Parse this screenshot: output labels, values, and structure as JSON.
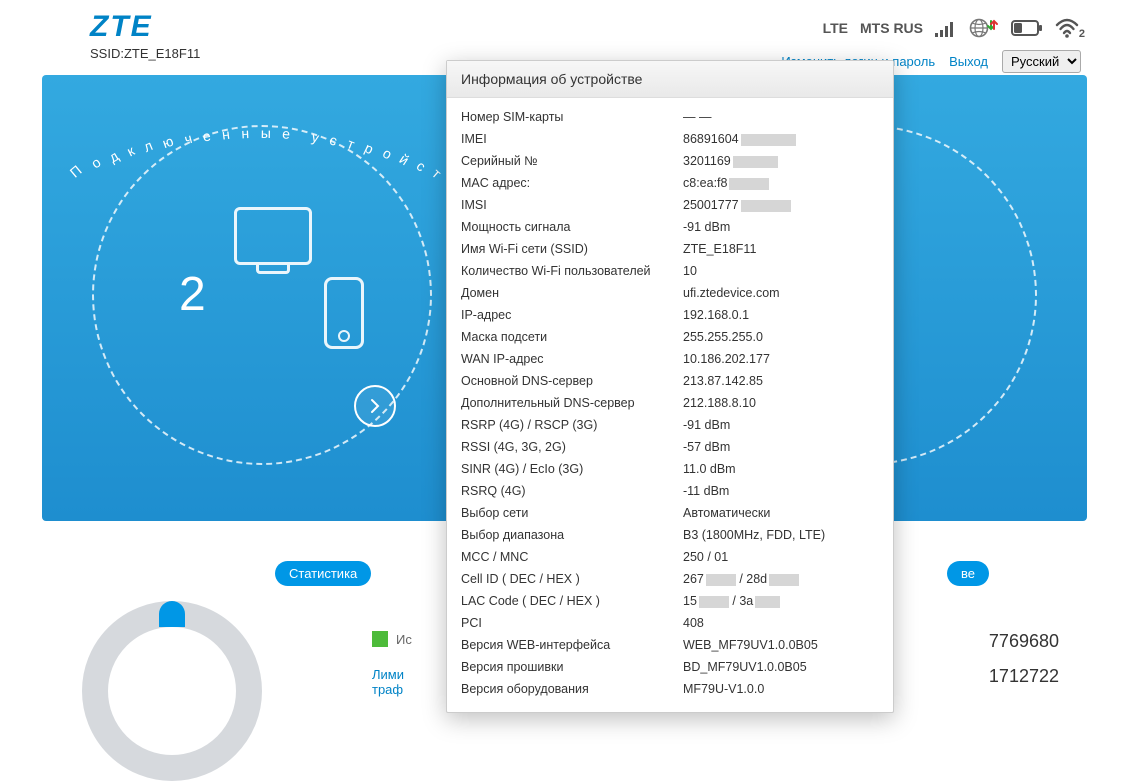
{
  "header": {
    "logo": "ZTE",
    "ssid_label": "SSID:",
    "ssid_value": "ZTE_E18F11",
    "net_type": "LTE",
    "operator": "MTS RUS",
    "change_login": "Изменить логин и пароль",
    "logout": "Выход",
    "language": "Русский",
    "wifi_count": "2"
  },
  "hero": {
    "left_title": "Подключенные устройства",
    "device_count": "2"
  },
  "stats": {
    "badge_left": "Статистика",
    "used_label": "Ис",
    "limit_link": "Лими\nтраф",
    "badge_right": "ве",
    "num1": "7769680",
    "num2": "1712722"
  },
  "modal": {
    "title": "Информация об устройстве",
    "rows": [
      {
        "k": "Номер SIM-карты",
        "v": "— —"
      },
      {
        "k": "IMEI",
        "v": "86891604",
        "redact": 55
      },
      {
        "k": "Серийный №",
        "v": "3201169",
        "redact": 45
      },
      {
        "k": "MAC адрес:",
        "v": "c8:ea:f8",
        "redact": 40
      },
      {
        "k": "IMSI",
        "v": "25001777",
        "redact": 50
      },
      {
        "k": "Мощность сигнала",
        "v": "-91 dBm"
      },
      {
        "k": "Имя Wi-Fi сети (SSID)",
        "v": "ZTE_E18F11"
      },
      {
        "k": "Количество Wi-Fi пользователей",
        "v": "10"
      },
      {
        "k": "Домен",
        "v": "ufi.ztedevice.com"
      },
      {
        "k": "IP-адрес",
        "v": "192.168.0.1"
      },
      {
        "k": "Маска подсети",
        "v": "255.255.255.0"
      },
      {
        "k": "WAN IP-адрес",
        "v": "10.186.202.177"
      },
      {
        "k": "Основной DNS-сервер",
        "v": "213.87.142.85"
      },
      {
        "k": "Дополнительный DNS-сервер",
        "v": "212.188.8.10"
      },
      {
        "k": "RSRP (4G) / RSCP (3G)",
        "v": "-91 dBm"
      },
      {
        "k": "RSSI (4G, 3G, 2G)",
        "v": "-57 dBm"
      },
      {
        "k": "SINR (4G) / EcIo (3G)",
        "v": "11.0 dBm"
      },
      {
        "k": "RSRQ (4G)",
        "v": "-11 dBm"
      },
      {
        "k": "Выбор сети",
        "v": "Автоматически"
      },
      {
        "k": "Выбор диапазона",
        "v": "B3 (1800MHz, FDD, LTE)"
      },
      {
        "k": "MCC / MNC",
        "v": "250 / 01"
      },
      {
        "k": "Cell ID ( DEC / HEX )",
        "v": "267",
        "redact": 30,
        "v2": " / 28d",
        "redact2": 30
      },
      {
        "k": "LAC Code ( DEC / HEX )",
        "v": "15",
        "redact": 30,
        "v2": " / 3a",
        "redact2": 25
      },
      {
        "k": "PCI",
        "v": "408"
      },
      {
        "k": "Версия WEB-интерфейса",
        "v": "WEB_MF79UV1.0.0B05"
      },
      {
        "k": "Версия прошивки",
        "v": "BD_MF79UV1.0.0B05"
      },
      {
        "k": "Версия оборудования",
        "v": "MF79U-V1.0.0"
      }
    ]
  }
}
